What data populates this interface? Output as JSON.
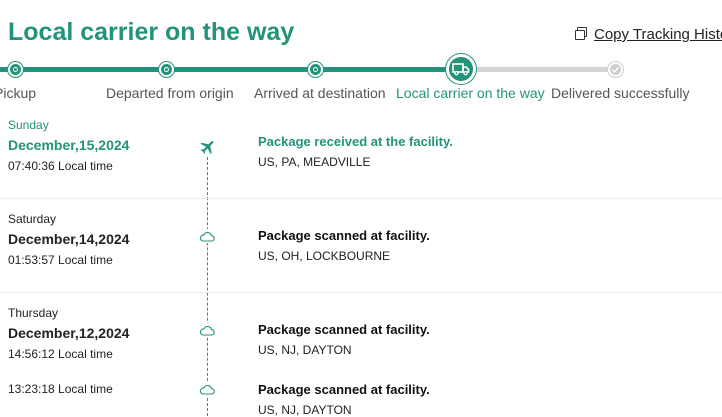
{
  "header": {
    "title": "Local carrier on the way",
    "copy_label": "Copy Tracking History"
  },
  "progress": {
    "steps": [
      {
        "label": "Pickup",
        "status": "done"
      },
      {
        "label": "Departed from origin",
        "status": "done"
      },
      {
        "label": "Arrived at destination",
        "status": "done"
      },
      {
        "label": "Local carrier on the way",
        "status": "current"
      },
      {
        "label": "Delivered successfully",
        "status": "pending"
      }
    ]
  },
  "events": [
    {
      "day": "Sunday",
      "date": "December,15,2024",
      "time": "07:40:36 Local time",
      "description": "Package received at the facility.",
      "location": "US, PA, MEADVILLE",
      "icon": "airplane-icon",
      "latest": true
    },
    {
      "day": "Saturday",
      "date": "December,14,2024",
      "time": "01:53:57 Local time",
      "description": "Package scanned at facility.",
      "location": "US, OH, LOCKBOURNE",
      "icon": "cloud-icon"
    },
    {
      "day": "Thursday",
      "date": "December,12,2024",
      "time": "14:56:12 Local time",
      "description": "Package scanned at facility.",
      "location": "US, NJ, DAYTON",
      "icon": "cloud-icon"
    },
    {
      "day": "",
      "date": "",
      "time": "13:23:18 Local time",
      "description": "Package scanned at facility.",
      "location": "US, NJ, DAYTON",
      "icon": "cloud-icon"
    }
  ],
  "colors": {
    "accent": "#23937a",
    "pending": "#d4d4d4",
    "divider": "#ececec"
  }
}
